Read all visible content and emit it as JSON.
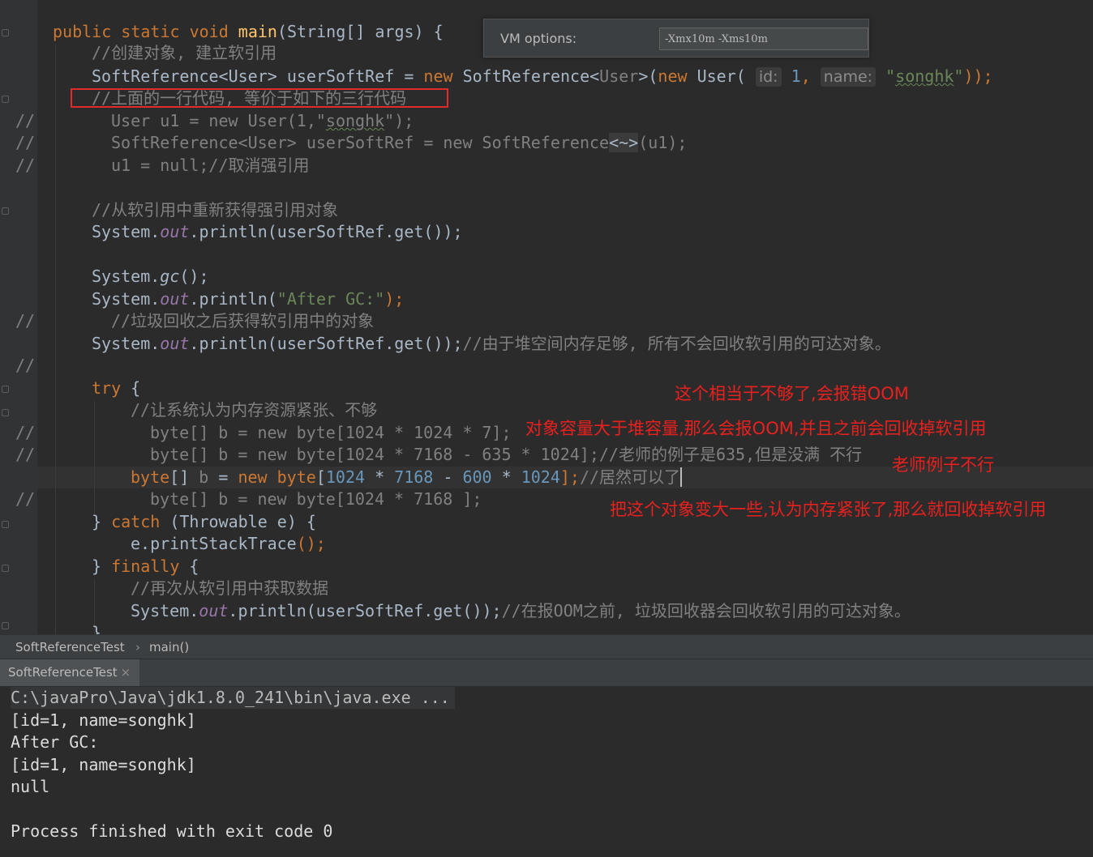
{
  "vm_options": {
    "label": "VM options:",
    "value": "-Xmx10m -Xms10m"
  },
  "code": {
    "l1_kw": "public static void ",
    "l1_fn": "main",
    "l1_rest": "(String[] args) {",
    "l2": "//创建对象, 建立软引用",
    "l3_a": "SoftReference<User> userSoftRef = ",
    "l3_new": "new",
    "l3_b": " SoftReference<",
    "l3_user": "User",
    "l3_c": ">(",
    "l3_new2": "new",
    "l3_d": " User( ",
    "l3_hint1": "id:",
    "l3_num": " 1",
    "l3_comma": ", ",
    "l3_hint2": "name:",
    "l3_str_q1": " \"",
    "l3_str": "songhk",
    "l3_str_q2": "\"",
    "l3_end": "));",
    "l4": "//上面的一行代码, 等价于如下的三行代码",
    "l5_a": "User u1 = new User(1,\"",
    "l5_str": "songhk",
    "l5_b": "\");",
    "l6_a": "SoftReference<User> userSoftRef = new SoftReference",
    "l6_fold": "<~>",
    "l6_b": "(u1);",
    "l7": "u1 = null;//取消强引用",
    "l8": "//从软引用中重新获得强引用对象",
    "l9_a": "System.",
    "l9_out": "out",
    "l9_b": ".println(userSoftRef.get());",
    "l10_a": "System.",
    "l10_gc": "gc",
    "l10_b": "();",
    "l11_a": "System.",
    "l11_out": "out",
    "l11_b": ".println(",
    "l11_str": "\"After GC:\"",
    "l11_c": ");",
    "l12": "//垃圾回收之后获得软引用中的对象",
    "l13_a": "System.",
    "l13_out": "out",
    "l13_b": ".println(userSoftRef.get());",
    "l13_cm": "//由于堆空间内存足够, 所有不会回收软引用的可达对象。",
    "l14_kw": "try",
    "l14_b": " {",
    "l15": "//让系统认为内存资源紧张、不够",
    "l16": "byte[] b = new byte[1024 * 1024 * 7];",
    "l17": "byte[] b = new byte[1024 * 7168 - 635 * 1024];//老师的例子是635,但是没满 不行",
    "l18_kw": "byte",
    "l18_a": "[] ",
    "l18_b": "b",
    "l18_c": " = ",
    "l18_new": "new",
    "l18_d": " byte",
    "l18_e": "[",
    "l18_n1": "1024",
    "l18_f": " * ",
    "l18_n2": "7168",
    "l18_g": " - ",
    "l18_n3": "600",
    "l18_h": " * ",
    "l18_n4": "1024",
    "l18_i": "];",
    "l18_cm": "//居然可以了",
    "l19": "byte[] b = new byte[1024 * 7168 ];",
    "l20_a": "} ",
    "l20_kw": "catch",
    "l20_b": " (Throwable e) {",
    "l21_a": "e.",
    "l21_b": "printStackTrace",
    "l21_c": "();",
    "l22_a": "} ",
    "l22_kw": "finally",
    "l22_b": " {",
    "l23": "//再次从软引用中获取数据",
    "l24_a": "System.",
    "l24_out": "out",
    "l24_b": ".println(userSoftRef.get());",
    "l24_cm": "//在报OOM之前, 垃圾回收器会回收软引用的可达对象。",
    "l25": "}",
    "gutter_comment": "//"
  },
  "annotations": {
    "a1": "这个相当于不够了,会报错OOM",
    "a2": "对象容量大于堆容量,那么会报OOM,并且之前会回收掉软引用",
    "a3": "老师例子不行",
    "a4": "把这个对象变大一些,认为内存紧张了,那么就回收掉软引用"
  },
  "breadcrumb": {
    "class_name": "SoftReferenceTest",
    "separator": "›",
    "method": "main()"
  },
  "run_tab": {
    "label": "SoftReferenceTest",
    "close": "×"
  },
  "console": [
    "C:\\javaPro\\Java\\jdk1.8.0_241\\bin\\java.exe ...",
    "[id=1, name=songhk]",
    "After GC:",
    "[id=1, name=songhk]",
    "null",
    "",
    "Process finished with exit code 0"
  ]
}
